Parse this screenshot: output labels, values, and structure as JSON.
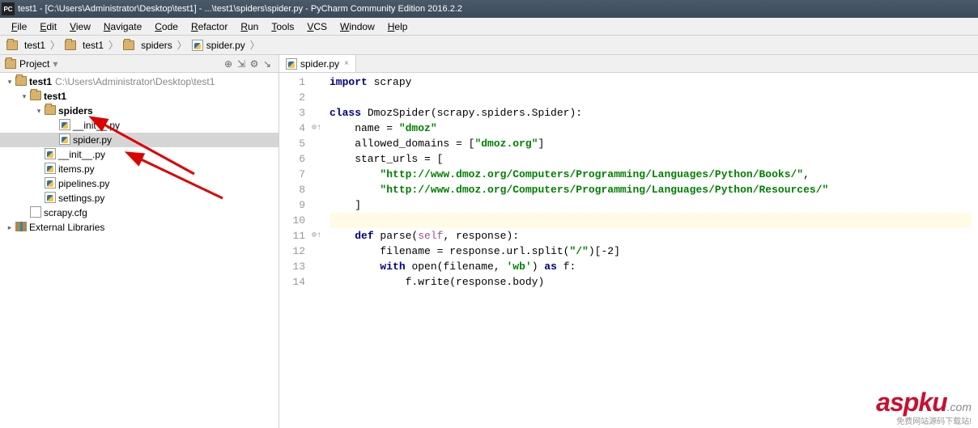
{
  "titlebar": "test1 - [C:\\Users\\Administrator\\Desktop\\test1] - ...\\test1\\spiders\\spider.py - PyCharm Community Edition 2016.2.2",
  "menu": [
    "File",
    "Edit",
    "View",
    "Navigate",
    "Code",
    "Refactor",
    "Run",
    "Tools",
    "VCS",
    "Window",
    "Help"
  ],
  "breadcrumbs": [
    {
      "icon": "folder",
      "label": "test1"
    },
    {
      "icon": "folder",
      "label": "test1"
    },
    {
      "icon": "folder",
      "label": "spiders"
    },
    {
      "icon": "py",
      "label": "spider.py"
    }
  ],
  "project_panel": {
    "title": "Project",
    "tree": [
      {
        "indent": 0,
        "arrow": "▾",
        "icon": "folder",
        "label": "test1",
        "path": "C:\\Users\\Administrator\\Desktop\\test1",
        "bold": true
      },
      {
        "indent": 1,
        "arrow": "▾",
        "icon": "folder",
        "label": "test1",
        "bold": true
      },
      {
        "indent": 2,
        "arrow": "▾",
        "icon": "folder",
        "label": "spiders",
        "bold": true
      },
      {
        "indent": 3,
        "arrow": "",
        "icon": "py",
        "label": "__init__.py"
      },
      {
        "indent": 3,
        "arrow": "",
        "icon": "py",
        "label": "spider.py",
        "selected": true
      },
      {
        "indent": 2,
        "arrow": "",
        "icon": "py",
        "label": "__init__.py"
      },
      {
        "indent": 2,
        "arrow": "",
        "icon": "py",
        "label": "items.py"
      },
      {
        "indent": 2,
        "arrow": "",
        "icon": "py",
        "label": "pipelines.py"
      },
      {
        "indent": 2,
        "arrow": "",
        "icon": "py",
        "label": "settings.py"
      },
      {
        "indent": 1,
        "arrow": "",
        "icon": "file",
        "label": "scrapy.cfg"
      },
      {
        "indent": 0,
        "arrow": "▸",
        "icon": "lib",
        "label": "External Libraries"
      }
    ]
  },
  "editor": {
    "tab_label": "spider.py",
    "lines": [
      {
        "n": 1,
        "html": "<span class='kw'>import</span> scrapy"
      },
      {
        "n": 2,
        "html": ""
      },
      {
        "n": 3,
        "html": "<span class='kw'>class</span> DmozSpider(scrapy.spiders.Spider):",
        "marker": ""
      },
      {
        "n": 4,
        "html": "    name = <span class='str'>\"dmoz\"</span>",
        "marker": "⊙↑"
      },
      {
        "n": 5,
        "html": "    allowed_domains = [<span class='str'>\"dmoz.org\"</span>]"
      },
      {
        "n": 6,
        "html": "    start_urls = ["
      },
      {
        "n": 7,
        "html": "        <span class='str'>\"http://www.dmoz.org/Computers/Programming/Languages/Python/Books/\"</span>,"
      },
      {
        "n": 8,
        "html": "        <span class='str'>\"http://www.dmoz.org/Computers/Programming/Languages/Python/Resources/\"</span>"
      },
      {
        "n": 9,
        "html": "    ]"
      },
      {
        "n": 10,
        "html": "",
        "hl": true
      },
      {
        "n": 11,
        "html": "    <span class='kw'>def</span> parse(<span class='self'>self</span>, response):",
        "marker": "⊙↑"
      },
      {
        "n": 12,
        "html": "        filename = response.url.split(<span class='str'>\"/\"</span>)[-2]"
      },
      {
        "n": 13,
        "html": "        <span class='kw'>with</span> open(filename, <span class='str'>'wb'</span>) <span class='kw'>as</span> f:"
      },
      {
        "n": 14,
        "html": "            f.write(response.body)"
      }
    ]
  },
  "watermark": {
    "brand": "aspku",
    "tld": ".com",
    "sub": "免费网站源码下载站!"
  }
}
